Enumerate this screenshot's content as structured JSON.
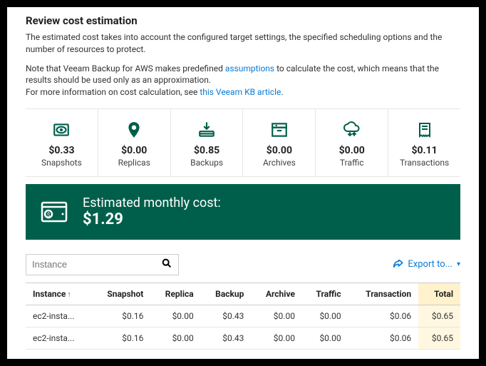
{
  "header": {
    "title": "Review cost estimation",
    "desc": "The estimated cost takes into account the configured target settings, the specified scheduling options and the number of resources to protect.",
    "note_pre": "Note that Veeam Backup for AWS makes predefined ",
    "note_link1": "assumptions",
    "note_mid": " to calculate the cost, which means that the results should be used only as an approximation.",
    "note_line2_pre": "For more information on cost calculation, see ",
    "note_link2": "this Veeam KB article",
    "note_end": "."
  },
  "cards": [
    {
      "value": "$0.33",
      "label": "Snapshots",
      "icon": "disk-icon"
    },
    {
      "value": "$0.00",
      "label": "Replicas",
      "icon": "pin-icon"
    },
    {
      "value": "$0.85",
      "label": "Backups",
      "icon": "download-drive-icon"
    },
    {
      "value": "$0.00",
      "label": "Archives",
      "icon": "archive-box-icon"
    },
    {
      "value": "$0.00",
      "label": "Traffic",
      "icon": "cloud-traffic-icon"
    },
    {
      "value": "$0.11",
      "label": "Transactions",
      "icon": "receipt-icon"
    }
  ],
  "banner": {
    "line1": "Estimated monthly cost:",
    "line2": "$1.29"
  },
  "search": {
    "placeholder": "Instance"
  },
  "export": {
    "label": "Export to..."
  },
  "table": {
    "columns": [
      "Instance",
      "Snapshot",
      "Replica",
      "Backup",
      "Archive",
      "Traffic",
      "Transaction",
      "Total"
    ],
    "rows": [
      {
        "instance": "ec2-insta...",
        "snapshot": "$0.16",
        "replica": "$0.00",
        "backup": "$0.43",
        "archive": "$0.00",
        "traffic": "$0.00",
        "transaction": "$0.06",
        "total": "$0.65"
      },
      {
        "instance": "ec2-insta...",
        "snapshot": "$0.16",
        "replica": "$0.00",
        "backup": "$0.43",
        "archive": "$0.00",
        "traffic": "$0.00",
        "transaction": "$0.06",
        "total": "$0.65"
      }
    ]
  }
}
